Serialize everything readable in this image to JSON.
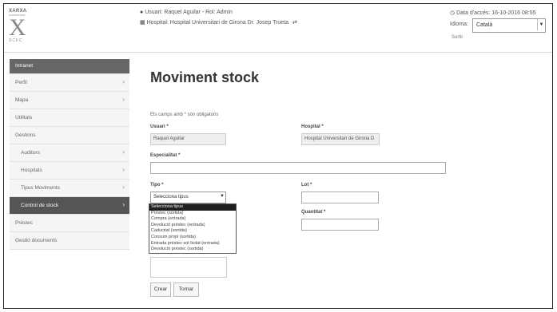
{
  "header": {
    "logo": {
      "line1": "XARXA",
      "line2": "D'INVENTARIS",
      "mark": "X",
      "line3": "SCFC"
    },
    "user_label": "Usuari: Raquel Aguilar - Rol: Admin",
    "hospital_label": "Hospital: Hospital Universitari de Girona Dr. Josep Trueta",
    "access_date": "Data d'accés: 16-10-2016 08:55",
    "language_label": "Idioma:",
    "language_value": "Català",
    "logout": "Sortir"
  },
  "sidebar": {
    "items": [
      {
        "label": "Intranet",
        "kind": "head",
        "chevron": false
      },
      {
        "label": "Perfil",
        "kind": "item",
        "chevron": true
      },
      {
        "label": "Mapa",
        "kind": "item",
        "chevron": true
      },
      {
        "label": "Utilitats",
        "kind": "item",
        "chevron": false
      },
      {
        "label": "Gestions",
        "kind": "item",
        "chevron": false
      },
      {
        "label": "Auditors",
        "kind": "sub",
        "chevron": true
      },
      {
        "label": "Hospitals",
        "kind": "sub",
        "chevron": true
      },
      {
        "label": "Tipus Moviments",
        "kind": "sub",
        "chevron": true
      },
      {
        "label": "Control de stock",
        "kind": "active",
        "chevron": true
      },
      {
        "label": "Préstec",
        "kind": "item",
        "chevron": false
      },
      {
        "label": "Gestió documents",
        "kind": "item",
        "chevron": false
      }
    ]
  },
  "form": {
    "title": "Moviment stock",
    "required_note": "Els camps amb * són obligatoris",
    "usuari_label": "Usuari *",
    "usuari_value": "Raquel Aguilar",
    "hospital_label": "Hospital *",
    "hospital_value": "Hospital Universitari de Girona D",
    "especialitat_label": "Especialitat *",
    "tipo_label": "Tipo *",
    "tipo_value": "Selecciona tipus",
    "lot_label": "Lot *",
    "quantitat_label": "Quantitat *",
    "tipo_options": [
      "Selecciona tipus",
      "Préstec (sortida)",
      "Compra (entrada)",
      "Devolució préstec (entrada)",
      "Caducitat (sortida)",
      "Consum propi (sortida)",
      "Entrada préstec sol·licitat (entrada)",
      "Devolució préstec (sortida)"
    ],
    "buttons": {
      "create": "Crear",
      "back": "Tornar"
    }
  }
}
